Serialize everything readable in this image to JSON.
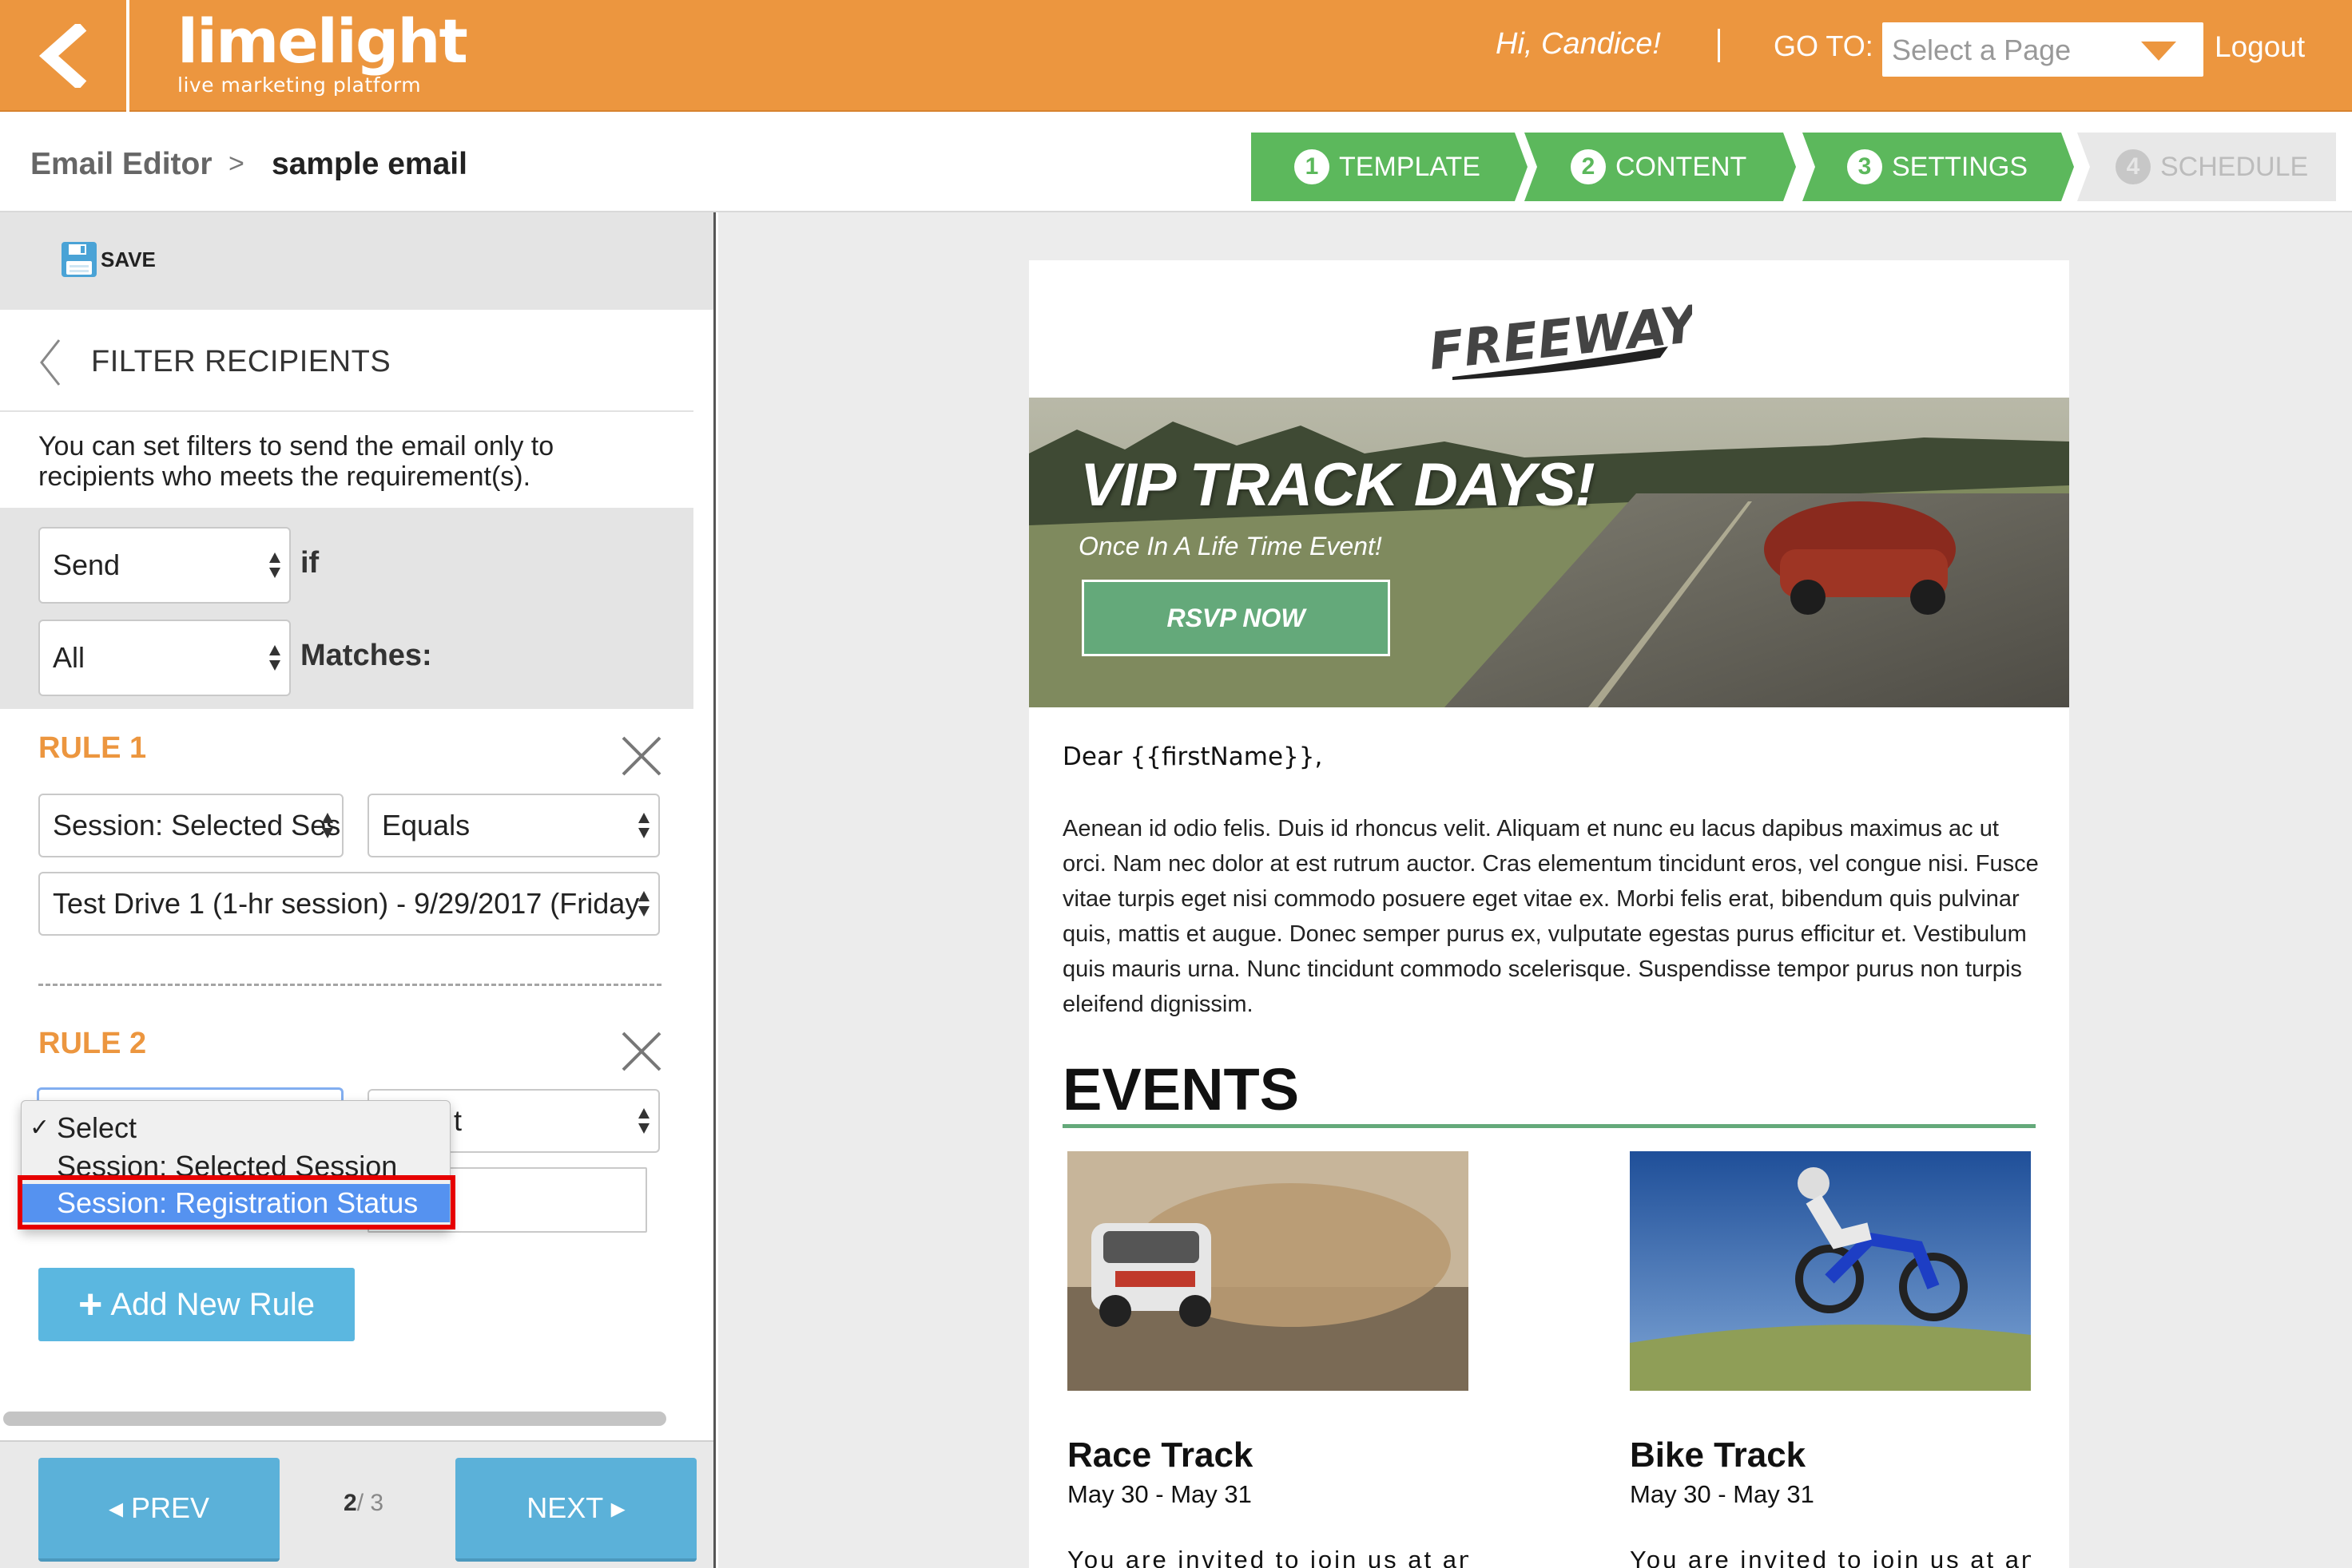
{
  "header": {
    "brand_word": "limelight",
    "brand_tagline": "live marketing platform",
    "greeting": "Hi,  Candice!",
    "goto_label": "GO TO:",
    "page_select_placeholder": "Select a Page",
    "logout_label": "Logout",
    "brand_color": "#ec963f"
  },
  "breadcrumb": {
    "root": "Email Editor",
    "separator": ">",
    "current": "sample email"
  },
  "steps": [
    {
      "num": "1",
      "label": "TEMPLATE",
      "state": "complete"
    },
    {
      "num": "2",
      "label": "CONTENT",
      "state": "complete"
    },
    {
      "num": "3",
      "label": "SETTINGS",
      "state": "complete"
    },
    {
      "num": "4",
      "label": "SCHEDULE",
      "state": "disabled"
    }
  ],
  "toolbar": {
    "save_label": "SAVE"
  },
  "filter": {
    "title": "FILTER RECIPIENTS",
    "description": "You can set filters to send the email only to recipients who meets the requirement(s).",
    "send_select_value": "Send",
    "if_label": "if",
    "match_select_value": "All",
    "matches_label": "Matches:"
  },
  "rules": [
    {
      "title": "RULE 1",
      "field_value": "Session: Selected Ses",
      "operator_value": "Equals",
      "target_value": "Test Drive 1 (1-hr session) - 9/29/2017 (Friday"
    },
    {
      "title": "RULE 2",
      "operator_value_partial": "t"
    }
  ],
  "rule_dropdown": {
    "options": [
      "Select",
      "Session: Selected Session",
      "Session: Registration Status"
    ],
    "checked_index": 0,
    "highlighted_index": 2
  },
  "add_rule_label": "Add New Rule",
  "pager": {
    "prev_label": "◂ PREV",
    "next_label": "NEXT ▸",
    "current_page": "2",
    "total_pages": "/ 3"
  },
  "email": {
    "logo_text": "FREEWAY",
    "hero_title": "VIP TRACK DAYS!",
    "hero_subtitle": "Once In A Life Time Event!",
    "hero_button": "RSVP NOW",
    "salutation": "Dear {{firstName}},",
    "body": "Aenean id odio felis. Duis id rhoncus velit. Aliquam et nunc eu lacus dapibus maximus ac ut orci. Nam nec dolor at est rutrum auctor. Cras elementum tincidunt eros, vel congue nisi. Fusce vitae turpis eget nisi commodo posuere eget vitae ex. Morbi felis erat, bibendum quis pulvinar quis, mattis et augue. Donec semper purus ex, vulputate egestas purus efficitur et. Vestibulum quis mauris urna. Nunc tincidunt commodo scelerisque. Suspendisse tempor purus non turpis eleifend dignissim.",
    "events_heading": "EVENTS",
    "events": [
      {
        "name": "Race Track",
        "date": "May 30 - May 31",
        "desc_start": "You are invited to join us at an"
      },
      {
        "name": "Bike Track",
        "date": "May 30 - May 31",
        "desc_start": "You are invited to join us at an"
      }
    ],
    "accent_color": "#64a97a"
  },
  "colors": {
    "step_green": "#5cb85c",
    "button_blue": "#5bb7e0",
    "rule_orange": "#ec963f",
    "dropdown_highlight": "#5592f0",
    "callout_red": "#e60000"
  }
}
